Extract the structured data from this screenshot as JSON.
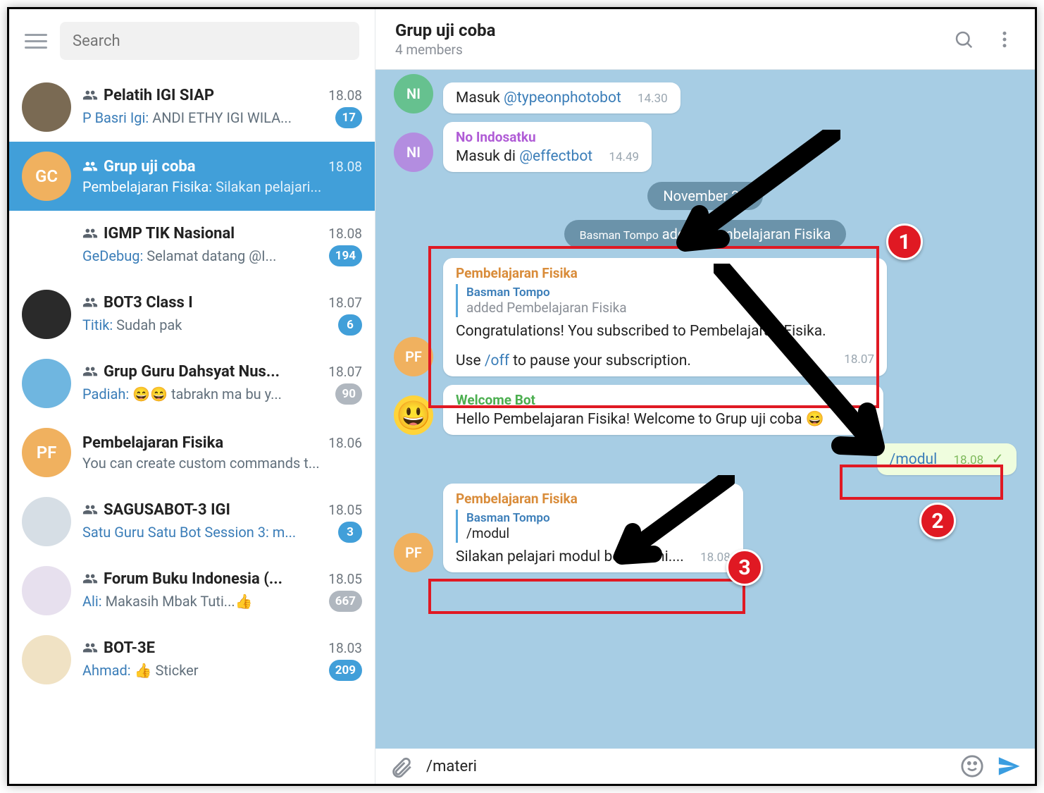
{
  "window": {
    "minimize": "_",
    "maximize": "▢",
    "close": "✕"
  },
  "search": {
    "placeholder": "Search"
  },
  "chats": [
    {
      "name": "Pelatih IGI SIAP",
      "time": "18.08",
      "sender": "P Basri Igi",
      "preview": "ANDI ETHY IGI WILA...",
      "badge": "17",
      "group": true,
      "avatarBg": "#7a6a53",
      "avatarText": ""
    },
    {
      "name": "Grup uji coba",
      "time": "18.08",
      "sender": "Pembelajaran Fisika",
      "preview": "Silakan pelajari...",
      "badge": "",
      "group": true,
      "selected": true,
      "avatarBg": "#f0b15f",
      "avatarText": "GC"
    },
    {
      "name": "IGMP TIK Nasional",
      "time": "18.08",
      "sender": "GeDebug",
      "preview": "Selamat datang  @I...",
      "badge": "194",
      "group": true,
      "avatarBg": "#fff",
      "avatarText": ""
    },
    {
      "name": "BOT3 Class I",
      "time": "18.07",
      "sender": "Titik",
      "preview": "Sudah pak",
      "badge": "6",
      "group": true,
      "avatarBg": "#2a2a2a",
      "avatarText": ""
    },
    {
      "name": "Grup Guru Dahsyat Nus...",
      "time": "18.07",
      "sender": "Padiah",
      "preview": "😄😄 tabrakn ma bu y...",
      "badge": "90",
      "badgeGray": true,
      "group": true,
      "avatarBg": "#6fb6e0",
      "avatarText": ""
    },
    {
      "name": "Pembelajaran Fisika",
      "time": "18.06",
      "sender": "",
      "preview": "You can create custom commands t...",
      "badge": "",
      "group": false,
      "avatarBg": "#f0b15f",
      "avatarText": "PF"
    },
    {
      "name": "SAGUSABOT-3 IGI",
      "time": "18.05",
      "sender": "",
      "preview": "Satu Guru Satu Bot Session 3: m...",
      "previewBlue": true,
      "badge": "3",
      "group": true,
      "avatarBg": "#d6dee5",
      "avatarText": ""
    },
    {
      "name": "Forum Buku Indonesia (...",
      "time": "18.05",
      "sender": "Ali",
      "preview": "Makasih Mbak Tuti...👍",
      "badge": "667",
      "badgeGray": true,
      "group": true,
      "avatarBg": "#e7e0ee",
      "avatarText": ""
    },
    {
      "name": "BOT-3E",
      "time": "18.03",
      "sender": "Ahmad",
      "preview": "👍 Sticker",
      "badge": "209",
      "group": true,
      "avatarBg": "#f0e2c4",
      "avatarText": ""
    }
  ],
  "header": {
    "title": "Grup uji coba",
    "subtitle": "4 members"
  },
  "messages": {
    "m1": {
      "avatar": "NI",
      "avatarBg": "#66c18f",
      "pre": "Masuk ",
      "link": "@typeonphotobot",
      "time": "14.30"
    },
    "m2": {
      "avatar": "NI",
      "avatarBg": "#b38de0",
      "sender": "No Indosatku",
      "pre": "Masuk di ",
      "link": "@effectbot",
      "time": "14.49"
    },
    "date": "November 27",
    "service": {
      "who": "Basman Tompo",
      "text": " added Pembelajaran Fisika"
    },
    "m3": {
      "avatar": "PF",
      "avatarBg": "#f0b15f",
      "sender": "Pembelajaran Fisika",
      "replyWho": "Basman Tompo",
      "replyWhat": "added Pembelajaran Fisika",
      "body1": "Congratulations! You subscribed to Pembelajaran Fisika.",
      "body2a": "Use ",
      "body2link": "/off",
      "body2b": " to pause your subscription.",
      "time": "18.07"
    },
    "m4": {
      "avatarEmoji": "😃",
      "sender": "Welcome Bot",
      "body": "Hello Pembelajaran Fisika! Welcome to Grup uji coba 😄",
      "time": "18.07"
    },
    "m5": {
      "body": "/modul",
      "time": "18.08"
    },
    "m6": {
      "avatar": "PF",
      "avatarBg": "#f0b15f",
      "sender": "Pembelajaran Fisika",
      "replyWho": "Basman Tompo",
      "replyWhat": "/modul",
      "body": "Silakan pelajari modul berikut ini....",
      "time": "18.08"
    }
  },
  "composer": {
    "value": "/materi"
  },
  "annotations": {
    "n1": "1",
    "n2": "2",
    "n3": "3"
  }
}
